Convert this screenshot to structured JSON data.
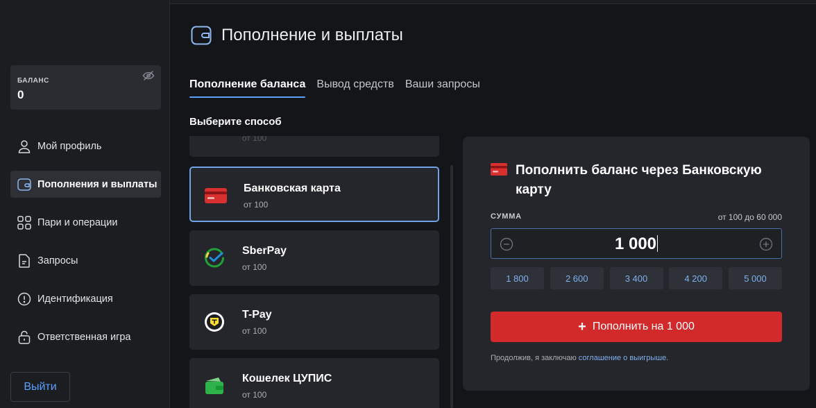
{
  "sidebar": {
    "balance_label": "БАЛАНС",
    "balance_value": "0",
    "items": [
      {
        "label": "Мой профиль",
        "icon": "user-icon"
      },
      {
        "label": "Пополнения и выплаты",
        "icon": "wallet-icon",
        "active": true
      },
      {
        "label": "Пари и операции",
        "icon": "grid-icon"
      },
      {
        "label": "Запросы",
        "icon": "document-icon"
      },
      {
        "label": "Идентификация",
        "icon": "alert-circle-icon"
      },
      {
        "label": "Ответственная игра",
        "icon": "lock-icon"
      }
    ],
    "logout_label": "Выйти"
  },
  "header": {
    "title": "Пополнение и выплаты"
  },
  "tabs": [
    {
      "label": "Пополнение баланса",
      "active": true
    },
    {
      "label": "Вывод средств"
    },
    {
      "label": "Ваши запросы"
    }
  ],
  "methods_title": "Выберите способ",
  "methods": [
    {
      "name": "",
      "min": "от 100"
    },
    {
      "name": "Банковская карта",
      "min": "от 100",
      "icon": "bank-card-icon",
      "selected": true
    },
    {
      "name": "SberPay",
      "min": "от 100",
      "icon": "sberpay-icon"
    },
    {
      "name": "T-Pay",
      "min": "от 100",
      "icon": "tpay-icon"
    },
    {
      "name": "Кошелек ЦУПИС",
      "min": "от 100",
      "icon": "cupis-wallet-icon"
    }
  ],
  "panel": {
    "title": "Пополнить баланс через Банковскую карту",
    "sum_label": "СУММА",
    "sum_range": "от 100 до 60 000",
    "sum_value": "1 000",
    "presets": [
      "1 800",
      "2 600",
      "3 400",
      "4 200",
      "5 000"
    ],
    "submit_label": "Пополнить на 1 000",
    "agree_text": "Продолжив, я заключаю ",
    "agree_link": "соглашение о выигрыше",
    "agree_end": "."
  },
  "colors": {
    "accent_blue": "#5aa0ff",
    "submit_red": "#d22a2a",
    "background": "#141518",
    "panel": "#24262b"
  }
}
